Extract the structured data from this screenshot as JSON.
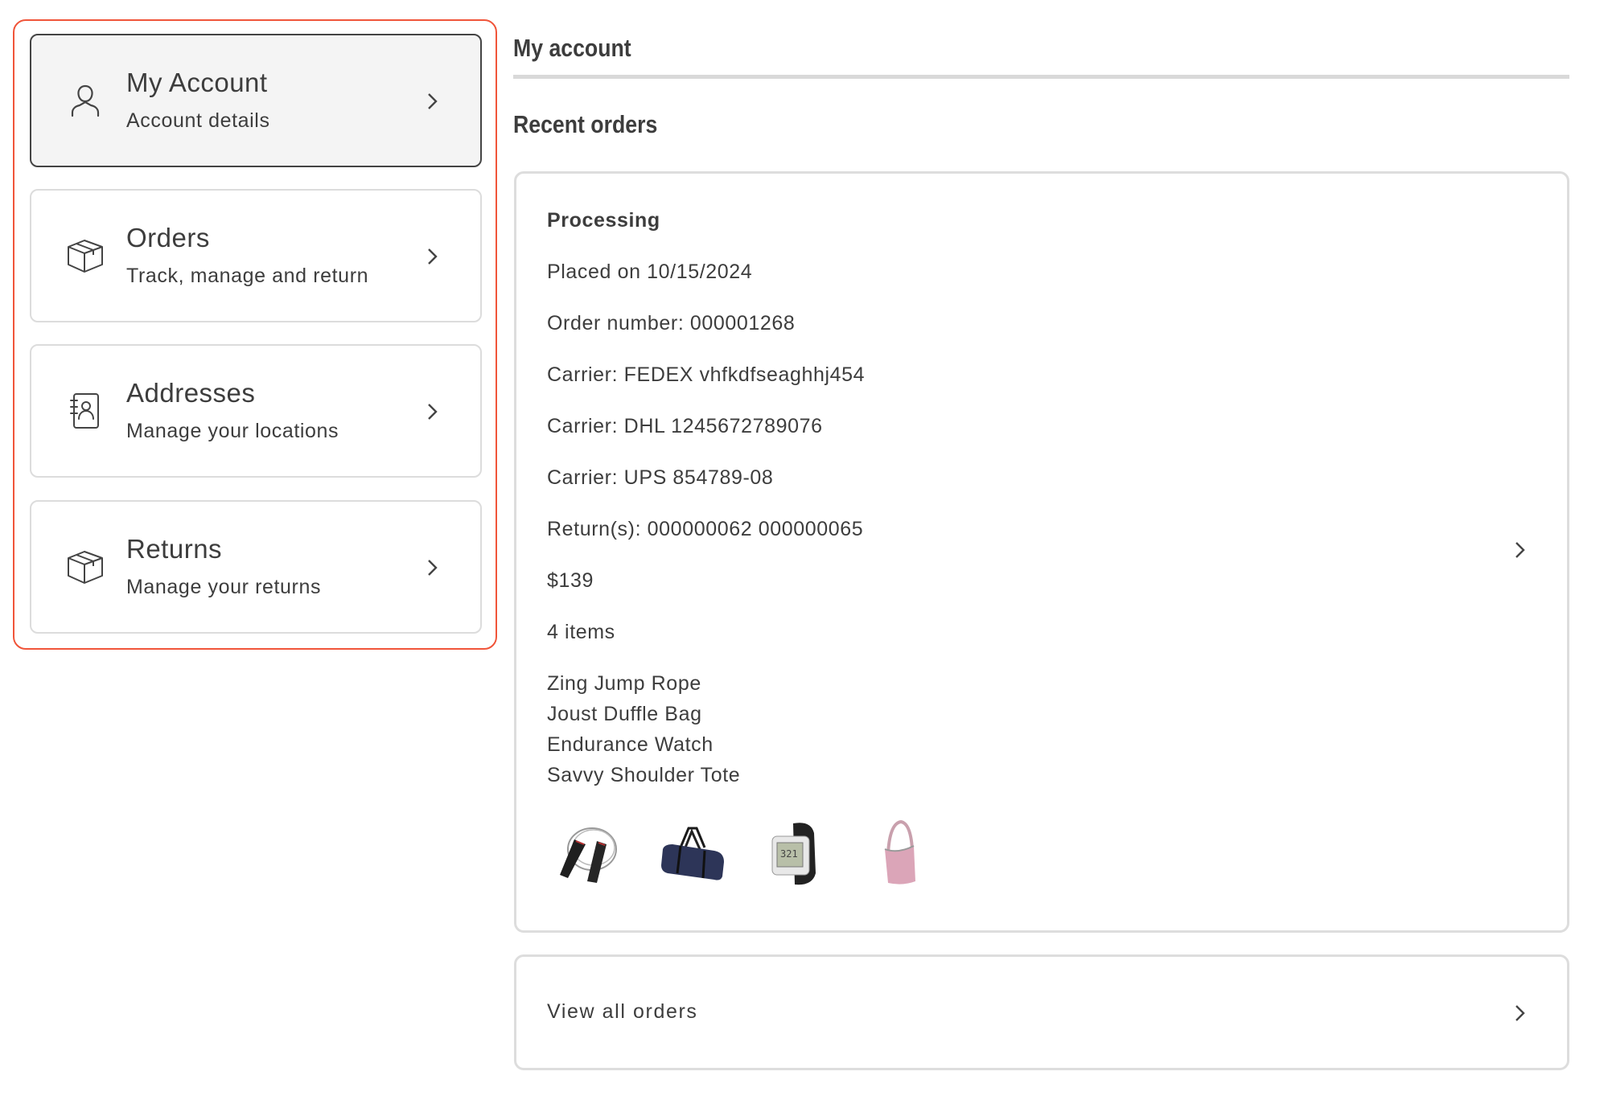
{
  "accent_color": "#f0553a",
  "sidebar": {
    "items": [
      {
        "title": "My Account",
        "subtitle": "Account details",
        "icon": "user-icon",
        "active": true
      },
      {
        "title": "Orders",
        "subtitle": "Track, manage and return",
        "icon": "box-icon",
        "active": false
      },
      {
        "title": "Addresses",
        "subtitle": "Manage your locations",
        "icon": "address-book-icon",
        "active": false
      },
      {
        "title": "Returns",
        "subtitle": "Manage your returns",
        "icon": "box-icon",
        "active": false
      }
    ]
  },
  "main": {
    "page_title": "My account",
    "section_title": "Recent orders",
    "order": {
      "status": "Processing",
      "placed_on": "Placed on 10/15/2024",
      "order_number": "Order number: 000001268",
      "carriers": [
        "Carrier: FEDEX vhfkdfseaghhj454",
        "Carrier: DHL 1245672789076",
        "Carrier: UPS 854789-08"
      ],
      "returns": "Return(s): 000000062 000000065",
      "total": "$139",
      "item_count": "4 items",
      "items": [
        {
          "name": "Zing Jump Rope",
          "image": "jump-rope-image"
        },
        {
          "name": "Joust Duffle Bag",
          "image": "duffle-bag-image"
        },
        {
          "name": "Endurance Watch",
          "image": "watch-image"
        },
        {
          "name": "Savvy Shoulder Tote",
          "image": "shoulder-tote-image"
        }
      ]
    },
    "view_all_label": "View all orders"
  }
}
